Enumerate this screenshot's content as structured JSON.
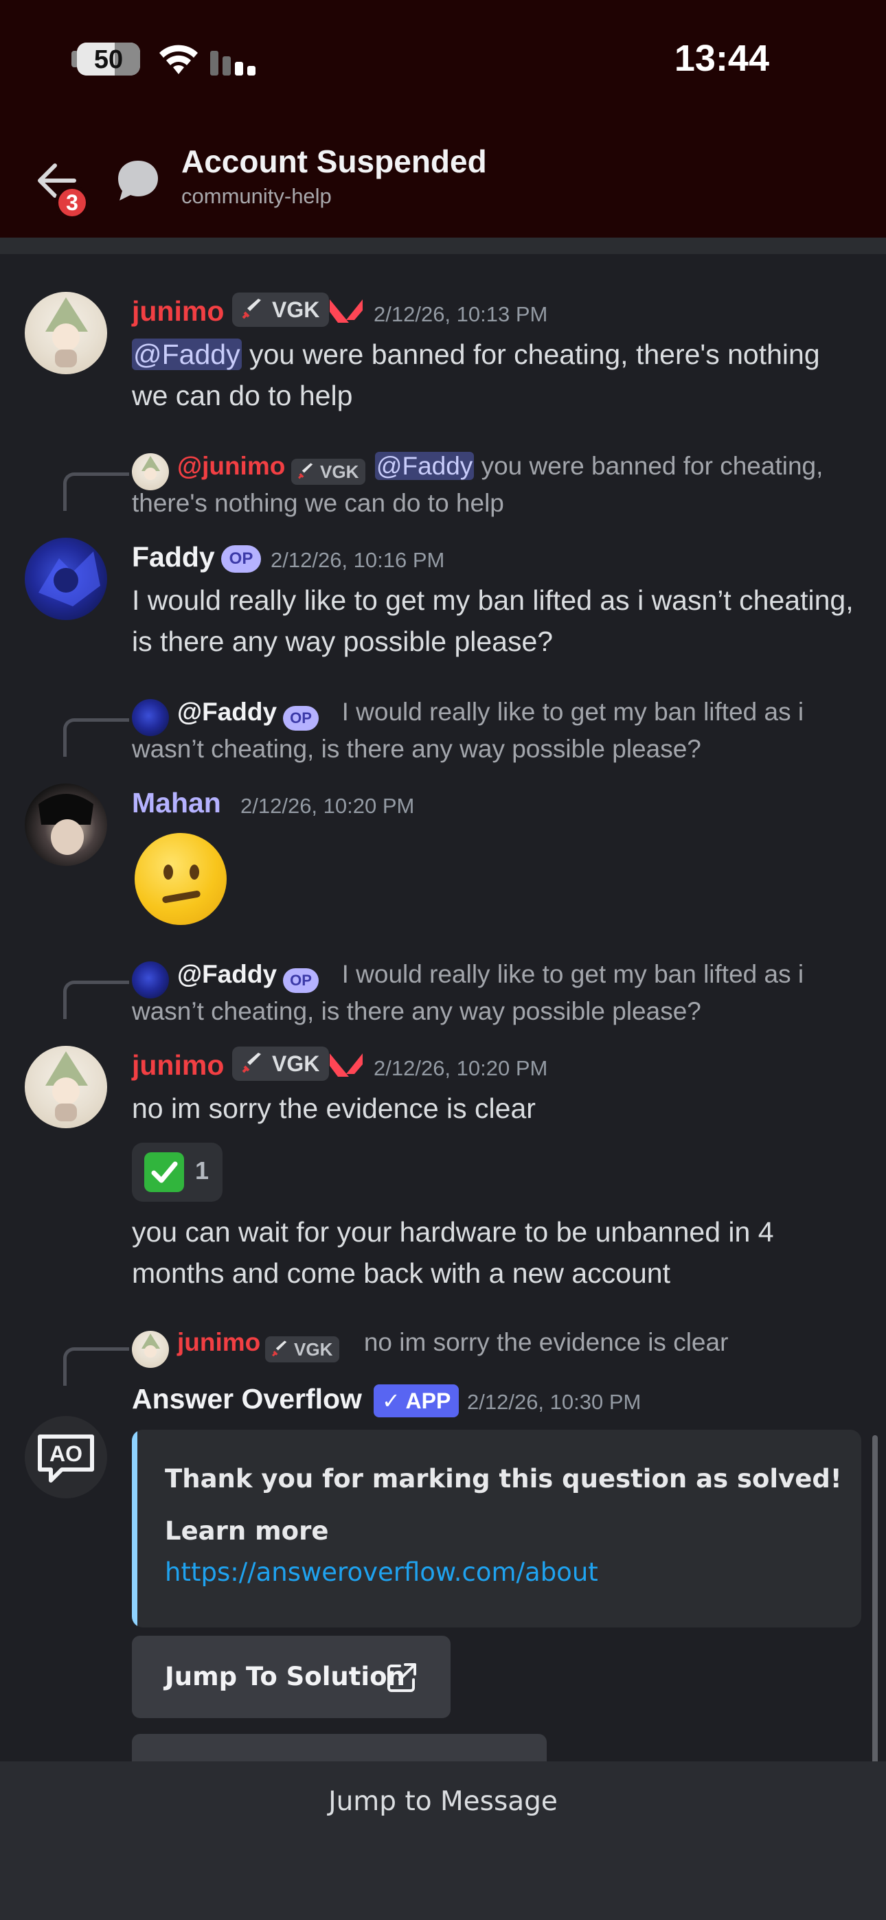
{
  "status_bar": {
    "battery": "50",
    "battery_level": 0.5,
    "time": "13:44"
  },
  "header": {
    "back_badge": "3",
    "title": "Account Suspended",
    "channel": "community-help"
  },
  "messages": [
    {
      "author": "junimo",
      "tag": "VGK",
      "timestamp": "2/12/26, 10:13 PM",
      "mention": "@Faddy",
      "text": " you were banned for cheating, there's nothing we can do to help"
    },
    {
      "reply_author": "@junimo",
      "reply_tag": "VGK",
      "reply_mention": "@Faddy",
      "reply_text": " you were banned for cheating, there's nothing we can do to help",
      "author": "Faddy",
      "badge": "OP",
      "timestamp": "2/12/26, 10:16 PM",
      "text": "I would really like to get my ban lifted as i wasn’t cheating, is there any way possible please?"
    },
    {
      "reply_author": "@Faddy",
      "reply_badge": "OP",
      "reply_text": "I would really like to get my ban lifted as i wasn’t cheating, is there any way possible please?",
      "author": "Mahan",
      "timestamp": "2/12/26, 10:20 PM",
      "emoji": "neutral-face"
    },
    {
      "reply_author": "@Faddy",
      "reply_badge": "OP",
      "reply_text": "I would really like to get my ban lifted as i wasn’t cheating, is there any way possible please?",
      "author": "junimo",
      "tag": "VGK",
      "timestamp": "2/12/26, 10:20 PM",
      "text": "no im sorry the evidence is clear",
      "reaction_count": "1",
      "text2": "you can wait for your hardware to be unbanned in 4 months and come back with a new account"
    },
    {
      "reply_author": "junimo",
      "reply_tag": "VGK",
      "reply_text": "no im sorry the evidence is clear",
      "author": "Answer Overflow",
      "app_tag": "✓ APP",
      "timestamp": "2/12/26, 10:30 PM",
      "embed_title": "Thank you for marking this question as solved!",
      "embed_subtitle": "Learn more",
      "embed_link": "https://answeroverflow.com/about",
      "button_label": "Jump To Solution"
    }
  ],
  "footer": {
    "jump_label": "Jump to Message"
  },
  "colors": {
    "header_bg": "#1f0303",
    "chat_bg": "#1e1f24",
    "mention_bg": "#3c4275",
    "red_name": "#f23f43",
    "purple_name": "#b5b2ff",
    "link": "#1fa3f0",
    "app_badge": "#5865f2"
  }
}
